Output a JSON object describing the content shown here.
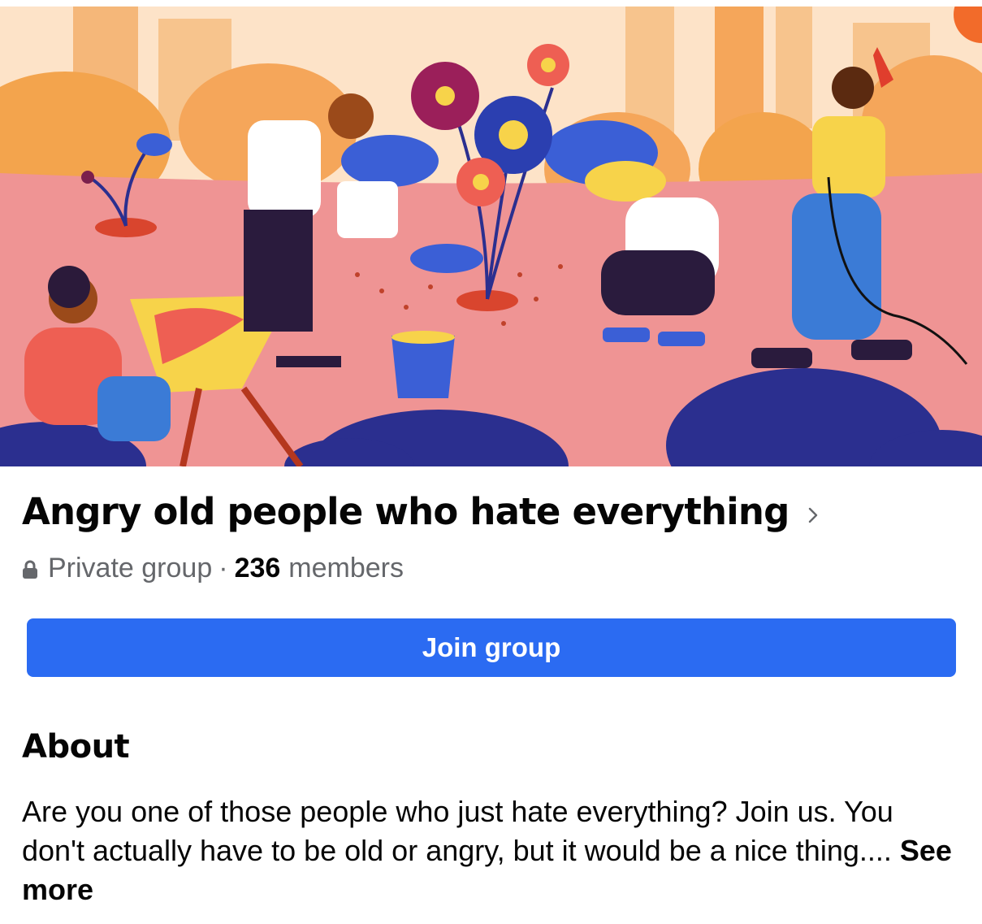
{
  "group": {
    "title": "Angry old people who hate everything",
    "privacy": "Private group",
    "separator": "·",
    "member_count": "236",
    "members_label": "members"
  },
  "actions": {
    "join_label": "Join group"
  },
  "about": {
    "heading": "About",
    "description": "Are you one of those people who just hate everything? Join us. You don't actually have to be old or angry, but it would be a nice thing.... ",
    "see_more_label": "See more"
  },
  "colors": {
    "primary_button": "#2b6bf2",
    "text_primary": "#050505",
    "text_secondary": "#65676b",
    "cover_ground": "#ef9494",
    "cover_sky": "#fde3c8"
  },
  "icons": {
    "privacy": "lock-icon",
    "title_action": "chevron-right-icon"
  }
}
